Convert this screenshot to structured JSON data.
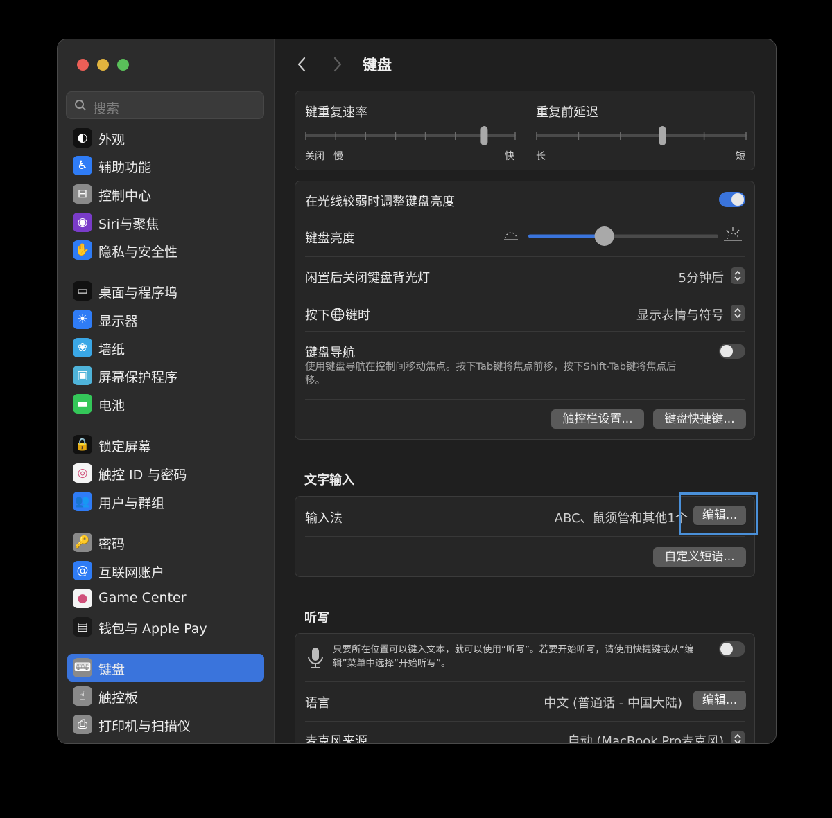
{
  "window": {
    "title": "键盘"
  },
  "search": {
    "placeholder": "搜索"
  },
  "sidebar": {
    "items": [
      {
        "label": "外观",
        "icon": "appearance-icon"
      },
      {
        "label": "辅助功能",
        "icon": "accessibility-icon"
      },
      {
        "label": "控制中心",
        "icon": "control-center-icon"
      },
      {
        "label": "Siri与聚焦",
        "icon": "siri-icon"
      },
      {
        "label": "隐私与安全性",
        "icon": "privacy-hand-icon"
      },
      {
        "label": "桌面与程序坞",
        "icon": "desktop-dock-icon"
      },
      {
        "label": "显示器",
        "icon": "display-icon"
      },
      {
        "label": "墙纸",
        "icon": "wallpaper-icon"
      },
      {
        "label": "屏幕保护程序",
        "icon": "screensaver-icon"
      },
      {
        "label": "电池",
        "icon": "battery-icon"
      },
      {
        "label": "锁定屏幕",
        "icon": "lock-screen-icon"
      },
      {
        "label": "触控 ID 与密码",
        "icon": "touch-id-icon"
      },
      {
        "label": "用户与群组",
        "icon": "users-icon"
      },
      {
        "label": "密码",
        "icon": "key-icon"
      },
      {
        "label": "互联网账户",
        "icon": "at-icon"
      },
      {
        "label": "Game Center",
        "icon": "game-center-icon"
      },
      {
        "label": "钱包与 Apple Pay",
        "icon": "wallet-icon"
      },
      {
        "label": "键盘",
        "icon": "keyboard-icon",
        "selected": true
      },
      {
        "label": "触控板",
        "icon": "trackpad-icon"
      },
      {
        "label": "打印机与扫描仪",
        "icon": "printer-icon"
      }
    ]
  },
  "repeat": {
    "rate_label": "键重复速率",
    "rate_left1": "关闭",
    "rate_left2": "慢",
    "rate_right": "快",
    "rate_value": 0.85,
    "delay_label": "重复前延迟",
    "delay_left": "长",
    "delay_right": "短",
    "delay_value": 0.6
  },
  "settings": {
    "auto_brightness_label": "在光线较弱时调整键盘亮度",
    "auto_brightness_on": true,
    "brightness_label": "键盘亮度",
    "brightness_value": 0.4,
    "backlight_off_label": "闲置后关闭键盘背光灯",
    "backlight_off_value": "5分钟后",
    "globe_label_pre": "按下",
    "globe_label_post": "键时",
    "globe_value": "显示表情与符号",
    "nav_label": "键盘导航",
    "nav_desc": "使用键盘导航在控制间移动焦点。按下Tab键将焦点前移，按下Shift-Tab键将焦点后移。",
    "nav_on": false,
    "touchbar_button": "触控栏设置...",
    "shortcuts_button": "键盘快捷键..."
  },
  "text_input": {
    "section": "文字输入",
    "input_label": "输入法",
    "input_value": "ABC、鼠须管和其他1个",
    "edit_button": "编辑...",
    "replacements_button": "自定义短语..."
  },
  "dictation": {
    "section": "听写",
    "desc": "只要所在位置可以键入文本，就可以使用“听写”。若要开始听写，请使用快捷键或从“编辑”菜单中选择“开始听写”。",
    "on": false,
    "language_label": "语言",
    "language_value": "中文 (普通话 - 中国大陆)",
    "language_edit": "编辑...",
    "mic_label": "麦克风来源",
    "mic_value": "自动 (MacBook Pro麦克风)"
  },
  "colors": {
    "accent": "#3a74dc",
    "highlight": "#4a90d9"
  }
}
